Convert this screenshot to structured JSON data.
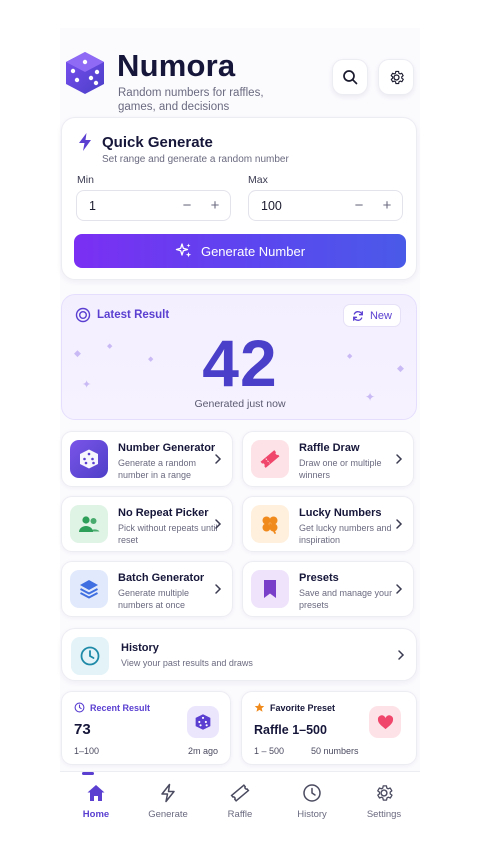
{
  "header": {
    "title": "Numora",
    "subtitle": "Random numbers for raffles, games, and decisions",
    "search_icon": "search-icon",
    "settings_icon": "gear-icon"
  },
  "quick_generate": {
    "title": "Quick Generate",
    "subtitle": "Set range and generate a random number",
    "min_label": "Min",
    "min_value": "1",
    "max_label": "Max",
    "max_value": "100",
    "minus": "−",
    "plus": "+",
    "button_label": "Generate Number"
  },
  "latest_result": {
    "title": "Latest Result",
    "new_label": "New",
    "value": "42",
    "caption": "Generated just now"
  },
  "tiles": [
    {
      "title": "Number Generator",
      "desc": "Generate a random number in a range",
      "icon": "dice-icon",
      "color": "#6b4fd8"
    },
    {
      "title": "Raffle Draw",
      "desc": "Draw one or multiple winners",
      "icon": "ticket-icon",
      "color": "#f0466b"
    },
    {
      "title": "No Repeat Picker",
      "desc": "Pick without repeats until reset",
      "icon": "users-icon",
      "color": "#2e9f58"
    },
    {
      "title": "Lucky Numbers",
      "desc": "Get lucky numbers and inspiration",
      "icon": "clover-icon",
      "color": "#f08a1c"
    },
    {
      "title": "Batch Generator",
      "desc": "Generate multiple numbers at once",
      "icon": "layers-icon",
      "color": "#3f6fe0"
    },
    {
      "title": "Presets",
      "desc": "Save and manage your presets",
      "icon": "bookmark-icon",
      "color": "#7a3fc8"
    }
  ],
  "history": {
    "title": "History",
    "desc": "View your past results and draws"
  },
  "recent_result": {
    "header": "Recent Result",
    "value": "73",
    "range": "1–100",
    "time": "2m ago"
  },
  "favorite_preset": {
    "header": "Favorite Preset",
    "value": "Raffle 1–500",
    "range": "1 – 500",
    "count": "50 numbers"
  },
  "nav": [
    {
      "label": "Home",
      "icon": "home-icon",
      "active": true
    },
    {
      "label": "Generate",
      "icon": "lightning-icon",
      "active": false
    },
    {
      "label": "Raffle",
      "icon": "ticket-icon",
      "active": false
    },
    {
      "label": "History",
      "icon": "clock-icon",
      "active": false
    },
    {
      "label": "Settings",
      "icon": "gear-icon",
      "active": false
    }
  ],
  "colors": {
    "accent": "#5a3fd1",
    "gradient_start": "#7b2ff2",
    "gradient_end": "#4a5ae8"
  }
}
